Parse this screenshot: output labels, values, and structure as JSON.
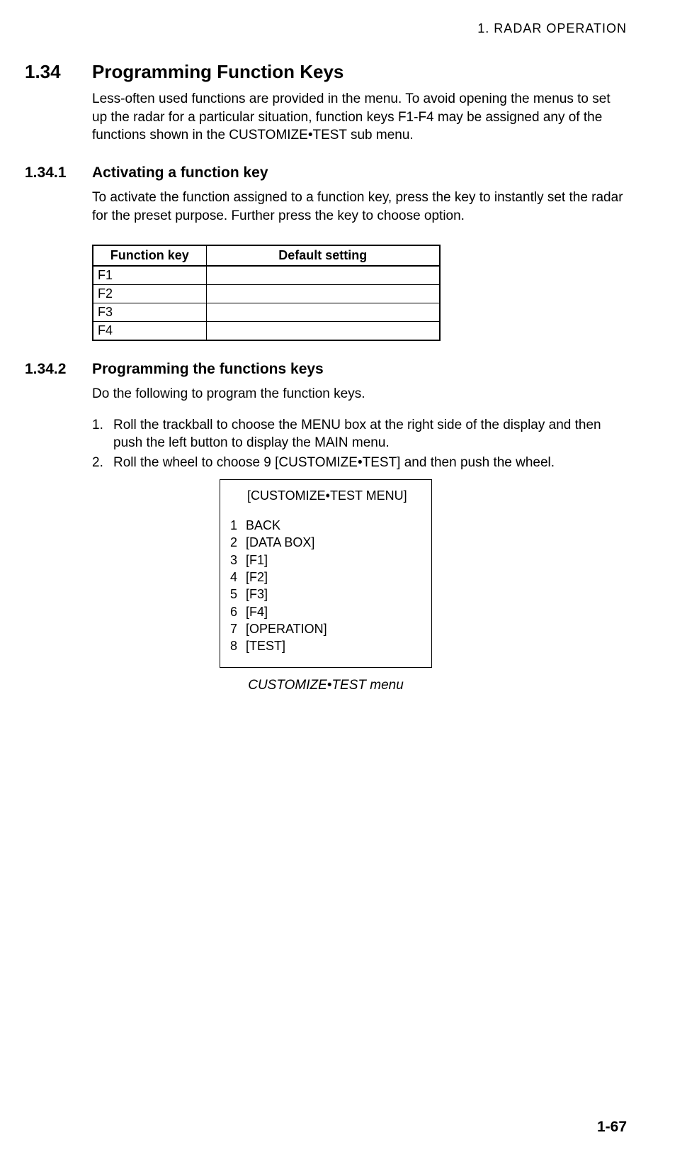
{
  "header": "1.  RADAR  OPERATION",
  "section_number": "1.34",
  "section_title": "Programming Function Keys",
  "section_body": "Less-often used functions are provided in the menu. To avoid opening the menus to set up the radar for a particular situation, function keys F1-F4 may be assigned any of the functions shown in the CUSTOMIZE•TEST sub menu.",
  "sub1_number": "1.34.1",
  "sub1_title": "Activating a function key",
  "sub1_body": "To activate the function assigned to a function key, press the key to instantly set the radar for the preset purpose. Further press the key to choose option.",
  "table": {
    "header_key": "Function key",
    "header_default": "Default setting",
    "rows": [
      {
        "key": "F1",
        "default": ""
      },
      {
        "key": "F2",
        "default": ""
      },
      {
        "key": "F3",
        "default": ""
      },
      {
        "key": "F4",
        "default": ""
      }
    ]
  },
  "sub2_number": "1.34.2",
  "sub2_title": "Programming the functions keys",
  "sub2_body": "Do the following to program the function keys.",
  "steps": [
    {
      "n": "1.",
      "t": "Roll the trackball to choose the MENU box at the right side of the display and then push the left button to display the MAIN menu."
    },
    {
      "n": "2.",
      "t": "Roll the wheel to choose 9 [CUSTOMIZE•TEST] and then push the wheel."
    }
  ],
  "menu": {
    "title": "[CUSTOMIZE•TEST MENU]",
    "items": [
      {
        "n": "1",
        "t": "BACK"
      },
      {
        "n": "2",
        "t": "[DATA BOX]"
      },
      {
        "n": "3",
        "t": "[F1]"
      },
      {
        "n": "4",
        "t": "[F2]"
      },
      {
        "n": "5",
        "t": "[F3]"
      },
      {
        "n": "6",
        "t": "[F4]"
      },
      {
        "n": "7",
        "t": "[OPERATION]"
      },
      {
        "n": "8",
        "t": "[TEST]"
      }
    ]
  },
  "menu_caption": "CUSTOMIZE•TEST menu",
  "page_number": "1-67"
}
